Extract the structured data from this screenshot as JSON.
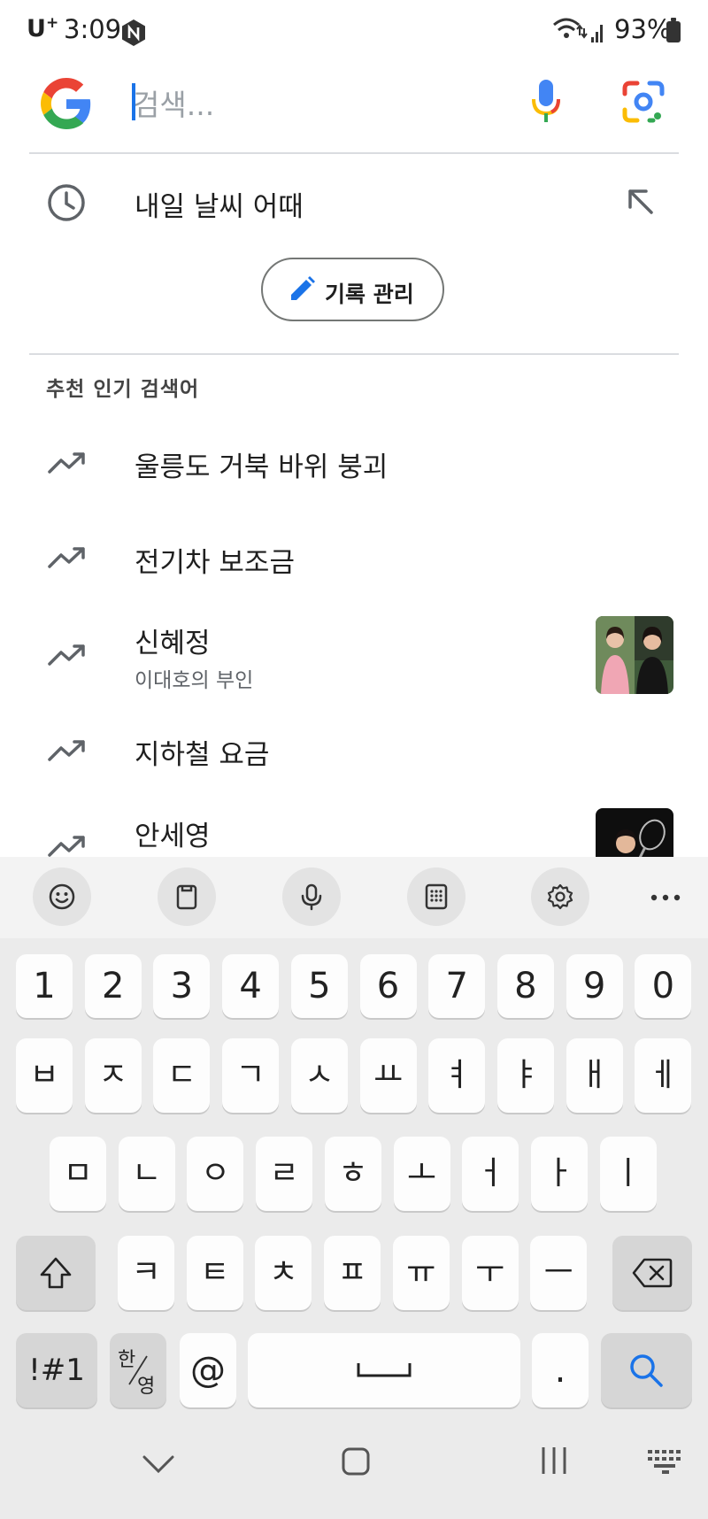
{
  "status_bar": {
    "carrier": "U",
    "carrier_sup": "+",
    "time": "3:09",
    "battery": "93%"
  },
  "search": {
    "placeholder": "검색..."
  },
  "history": {
    "items": [
      {
        "text": "내일 날씨 어때"
      }
    ],
    "manage_label": "기록 관리"
  },
  "trending": {
    "title": "추천 인기 검색어",
    "items": [
      {
        "text": "울릉도 거북 바위 붕괴",
        "subtitle": ""
      },
      {
        "text": "전기차 보조금",
        "subtitle": ""
      },
      {
        "text": "신혜정",
        "subtitle": "이대호의 부인"
      },
      {
        "text": "지하철 요금",
        "subtitle": ""
      },
      {
        "text": "안세영",
        "subtitle": ""
      }
    ]
  },
  "keyboard": {
    "number_row": [
      "1",
      "2",
      "3",
      "4",
      "5",
      "6",
      "7",
      "8",
      "9",
      "0"
    ],
    "row1": [
      "ㅂ",
      "ㅈ",
      "ㄷ",
      "ㄱ",
      "ㅅ",
      "ㅛ",
      "ㅕ",
      "ㅑ",
      "ㅐ",
      "ㅔ"
    ],
    "row2": [
      "ㅁ",
      "ㄴ",
      "ㅇ",
      "ㄹ",
      "ㅎ",
      "ㅗ",
      "ㅓ",
      "ㅏ",
      "ㅣ"
    ],
    "row3": [
      "ㅋ",
      "ㅌ",
      "ㅊ",
      "ㅍ",
      "ㅠ",
      "ㅜ",
      "ㅡ"
    ],
    "symbols_label": "!#1",
    "lang_top": "한",
    "lang_bottom": "영",
    "at_label": "@",
    "period_label": ".",
    "accent": "#1a73e8"
  },
  "colors": {
    "google_blue": "#4285F4",
    "google_red": "#EA4335",
    "google_yellow": "#FBBC05",
    "google_green": "#34A853"
  }
}
